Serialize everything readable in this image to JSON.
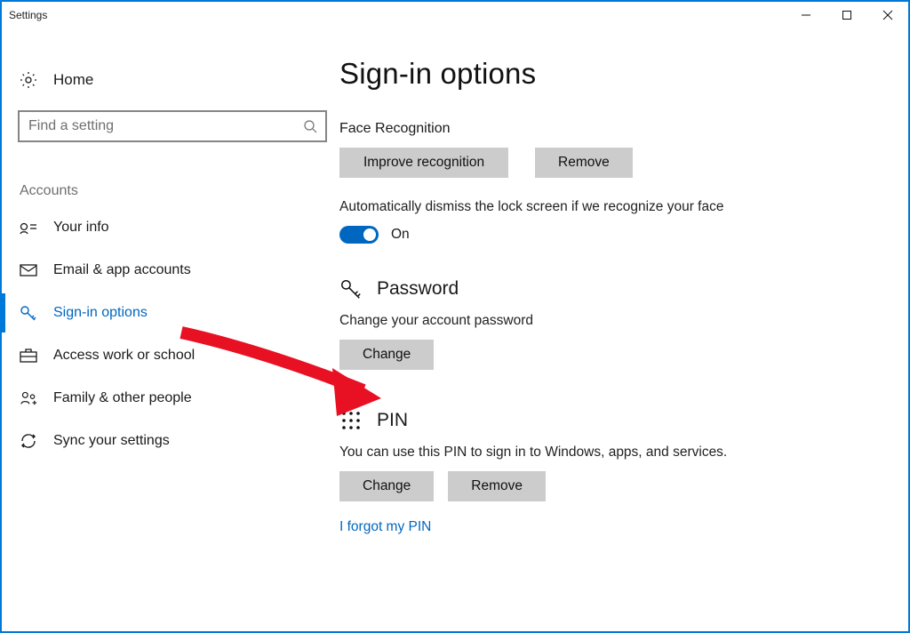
{
  "window": {
    "title": "Settings"
  },
  "sidebar": {
    "home_label": "Home",
    "search_placeholder": "Find a setting",
    "category": "Accounts",
    "items": [
      {
        "label": "Your info"
      },
      {
        "label": "Email & app accounts"
      },
      {
        "label": "Sign-in options"
      },
      {
        "label": "Access work or school"
      },
      {
        "label": "Family & other people"
      },
      {
        "label": "Sync your settings"
      }
    ]
  },
  "page": {
    "heading": "Sign-in options",
    "face": {
      "title": "Face Recognition",
      "improve_btn": "Improve recognition",
      "remove_btn": "Remove",
      "auto_dismiss_label": "Automatically dismiss the lock screen if we recognize your face",
      "toggle_state": "On"
    },
    "password": {
      "title": "Password",
      "desc": "Change your account password",
      "change_btn": "Change"
    },
    "pin": {
      "title": "PIN",
      "desc": "You can use this PIN to sign in to Windows, apps, and services.",
      "change_btn": "Change",
      "remove_btn": "Remove",
      "forgot_link": "I forgot my PIN"
    }
  },
  "colors": {
    "accent": "#0078D7",
    "link": "#0067C0"
  },
  "annotation": {
    "arrow_target": "password-change-button"
  }
}
